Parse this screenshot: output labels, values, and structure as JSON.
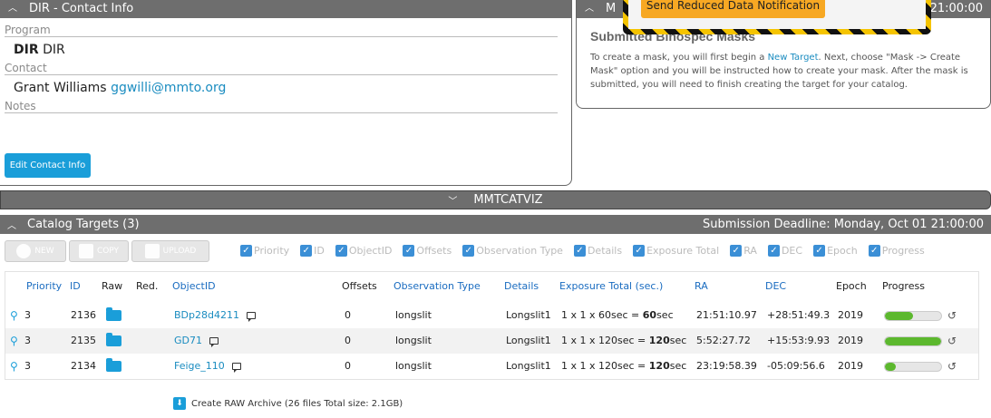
{
  "contact": {
    "header": "DIR - Contact Info",
    "program_label": "Program",
    "program_code": "DIR",
    "program_name": "DIR",
    "contact_label": "Contact",
    "contact_name": "Grant Williams",
    "contact_email": "ggwilli@mmto.org",
    "notes_label": "Notes",
    "edit_button": "Edit Contact Info"
  },
  "mask_panel": {
    "header_left": "M",
    "header_right": "4 21:00:00",
    "title": "Submitted Binospec Masks",
    "text_before": "To create a mask, you will first begin a ",
    "text_link": "New Target",
    "text_after": ". Next, choose \"Mask -> Create Mask\" option and you will be instructed how to create your mask. After the mask is submitted, you will need to finish creating the target for your catalog."
  },
  "notification_button": "Send Reduced Data Notification",
  "viz_bar": {
    "title": "MMTCATVIZ"
  },
  "catalog": {
    "header": "Catalog Targets (3)",
    "deadline": "Submission Deadline: Monday, Oct 01 21:00:00",
    "toolbar": {
      "new": "NEW",
      "copy": "COPY",
      "upload": "UPLOAD"
    },
    "toggles": [
      "Priority",
      "ID",
      "ObjectID",
      "Offsets",
      "Observation Type",
      "Details",
      "Exposure Total",
      "RA",
      "DEC",
      "Epoch",
      "Progress"
    ],
    "columns": {
      "priority": "Priority",
      "id": "ID",
      "raw": "Raw",
      "red": "Red.",
      "objectid": "ObjectID",
      "offsets": "Offsets",
      "obstype": "Observation Type",
      "details": "Details",
      "exposure": "Exposure Total (sec.)",
      "ra": "RA",
      "dec": "DEC",
      "epoch": "Epoch",
      "progress": "Progress"
    },
    "rows": [
      {
        "priority": "3",
        "id": "2136",
        "objectid": "BDp28d4211",
        "offsets": "0",
        "obstype": "longslit",
        "details": "Longslit1",
        "exposure_prefix": "1 x 1 x 60sec = ",
        "exposure_total": "60",
        "exposure_unit": "sec",
        "ra": "21:51:10.97",
        "dec": "+28:51:49.3",
        "epoch": "2019",
        "progress": 0.5
      },
      {
        "priority": "3",
        "id": "2135",
        "objectid": "GD71",
        "offsets": "0",
        "obstype": "longslit",
        "details": "Longslit1",
        "exposure_prefix": "1 x 1 x 120sec = ",
        "exposure_total": "120",
        "exposure_unit": "sec",
        "ra": "5:52:27.72",
        "dec": "+15:53:9.93",
        "epoch": "2019",
        "progress": 1.0
      },
      {
        "priority": "3",
        "id": "2134",
        "objectid": "Feige_110",
        "offsets": "0",
        "obstype": "longslit",
        "details": "Longslit1",
        "exposure_prefix": "1 x 1 x 120sec = ",
        "exposure_total": "120",
        "exposure_unit": "sec",
        "ra": "23:19:58.39",
        "dec": "-05:09:56.6",
        "epoch": "2019",
        "progress": 0.2
      }
    ],
    "archive": "Create RAW Archive (26 files Total size: 2.1GB)"
  }
}
